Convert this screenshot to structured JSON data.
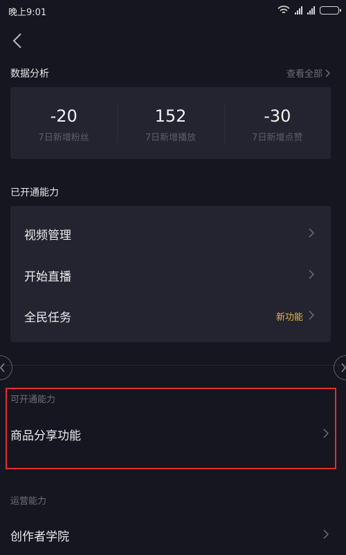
{
  "status_bar": {
    "time": "晚上9:01",
    "icons": [
      "wifi-icon",
      "signal-icon",
      "signal-icon",
      "battery-icon"
    ]
  },
  "nav": {
    "back_icon": "chevron-left-icon"
  },
  "data_analysis": {
    "title": "数据分析",
    "view_all": "查看全部",
    "stats": [
      {
        "value": "-20",
        "label": "7日新增粉丝"
      },
      {
        "value": "152",
        "label": "7日新增播放"
      },
      {
        "value": "-30",
        "label": "7日新增点赞"
      }
    ]
  },
  "opened_capabilities": {
    "title": "已开通能力",
    "items": [
      {
        "label": "视频管理"
      },
      {
        "label": "开始直播"
      },
      {
        "label": "全民任务",
        "badge": "新功能"
      }
    ]
  },
  "available_capabilities": {
    "title": "可开通能力",
    "items": [
      {
        "label": "商品分享功能"
      }
    ]
  },
  "operation_capabilities": {
    "title": "运营能力",
    "items": [
      {
        "label": "创作者学院"
      }
    ]
  },
  "colors": {
    "background": "#15161f",
    "card": "#232430",
    "badge": "#e7b93d",
    "highlight": "#e0312f"
  }
}
